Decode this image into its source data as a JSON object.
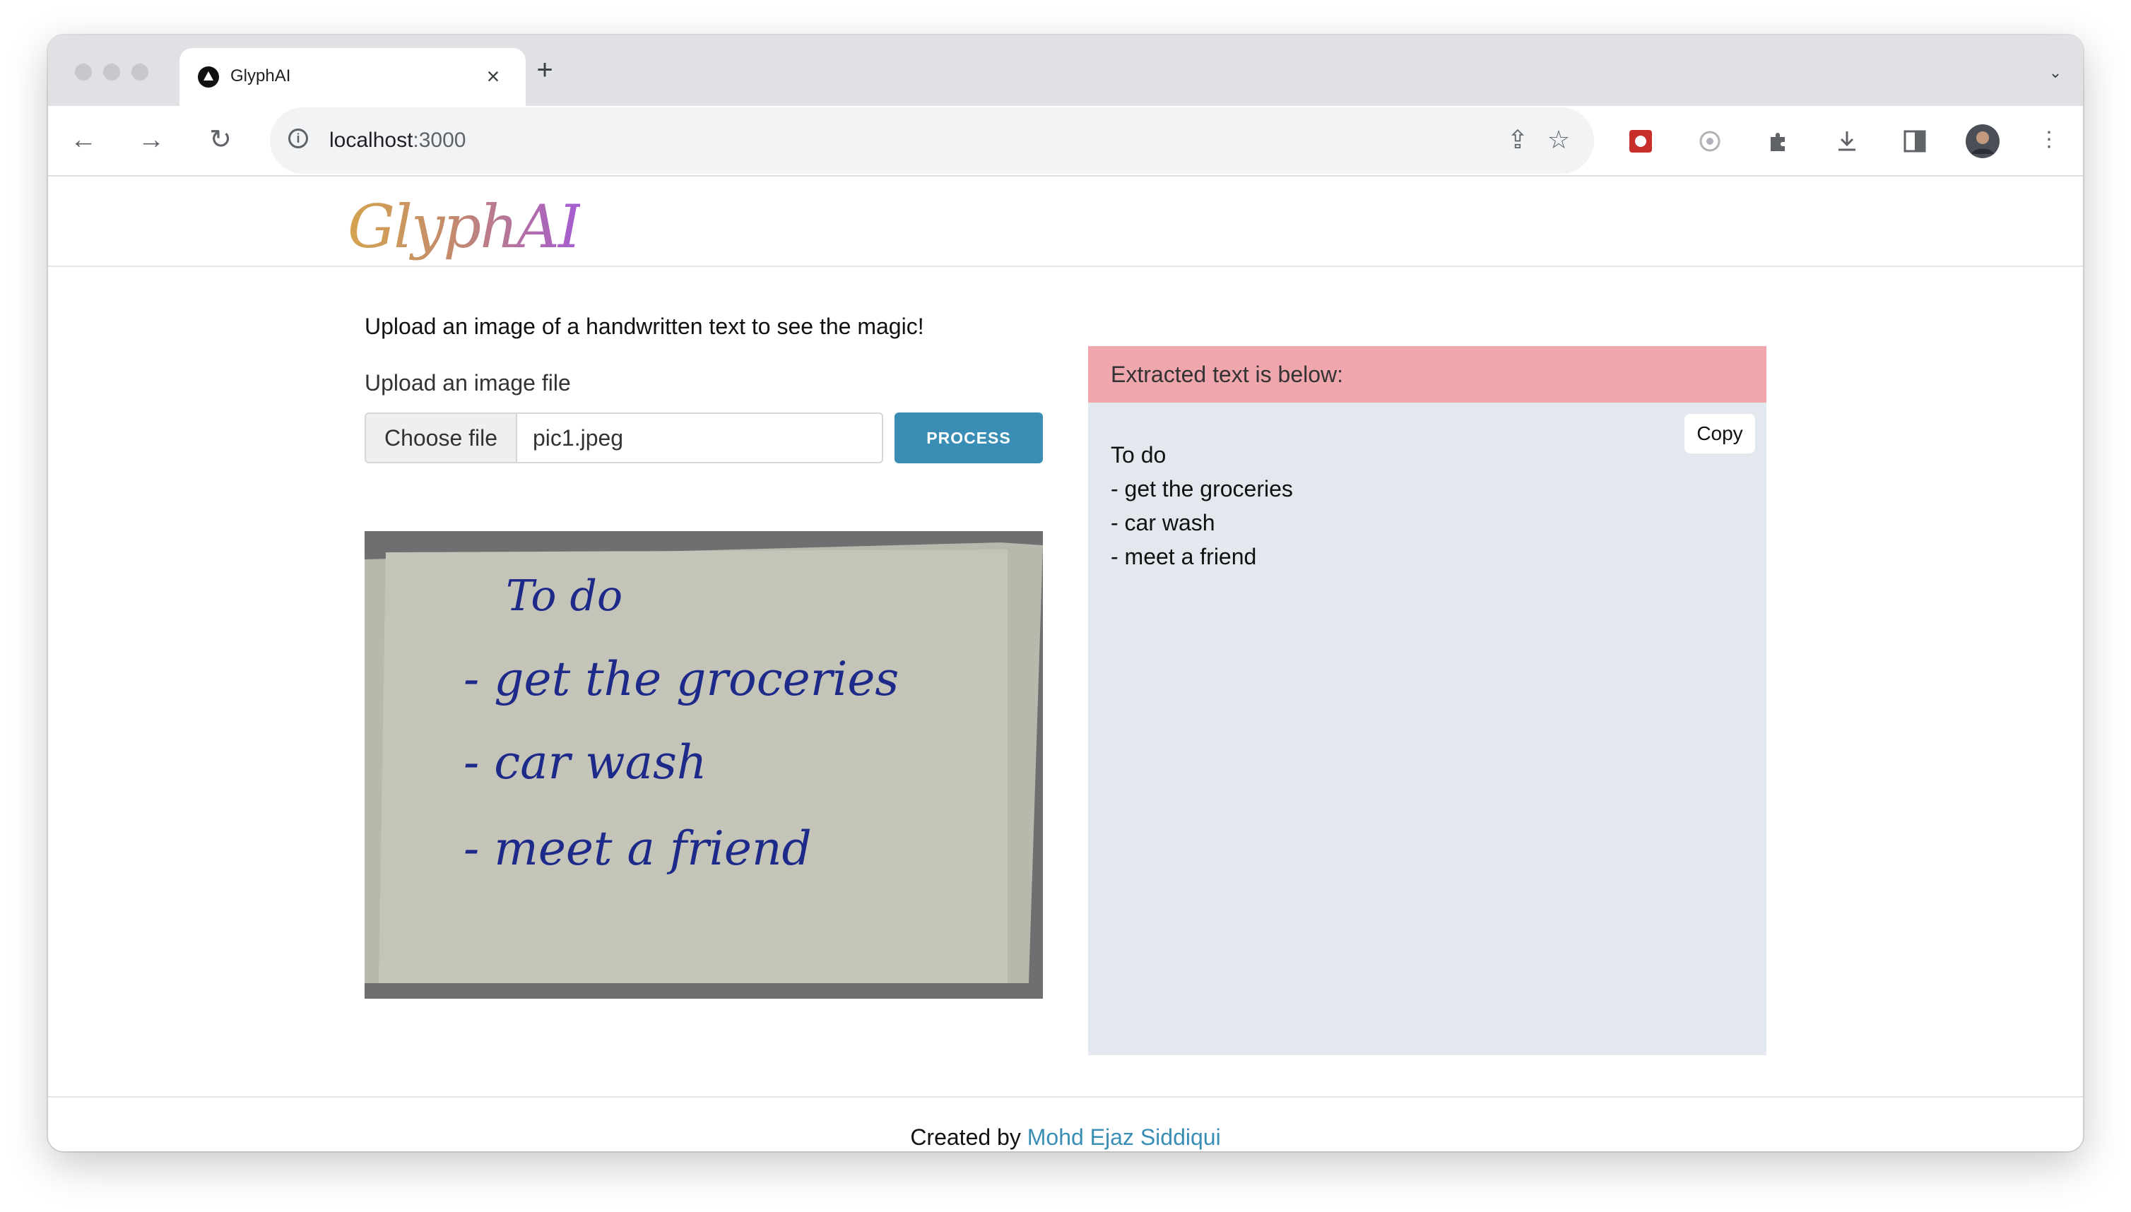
{
  "browser": {
    "tab": {
      "title": "GlyphAI"
    },
    "url": {
      "host": "localhost",
      "port": ":3000"
    }
  },
  "app": {
    "brand": "GlyphAI",
    "intro": "Upload an image of a handwritten text to see the magic!",
    "upload": {
      "label": "Upload an image file",
      "choose_button": "Choose file",
      "file_name": "pic1.jpeg",
      "process_button": "PROCESS"
    },
    "preview_handwriting": [
      "To do",
      "- get the groceries",
      "- car wash",
      "- meet a friend"
    ],
    "result": {
      "header": "Extracted text is below:",
      "copy_button": "Copy",
      "lines": [
        "To do",
        "- get the groceries",
        "- car wash",
        "- meet a friend"
      ]
    },
    "footer": {
      "prefix": "Created by ",
      "author": "Mohd Ejaz Siddiqui"
    }
  }
}
